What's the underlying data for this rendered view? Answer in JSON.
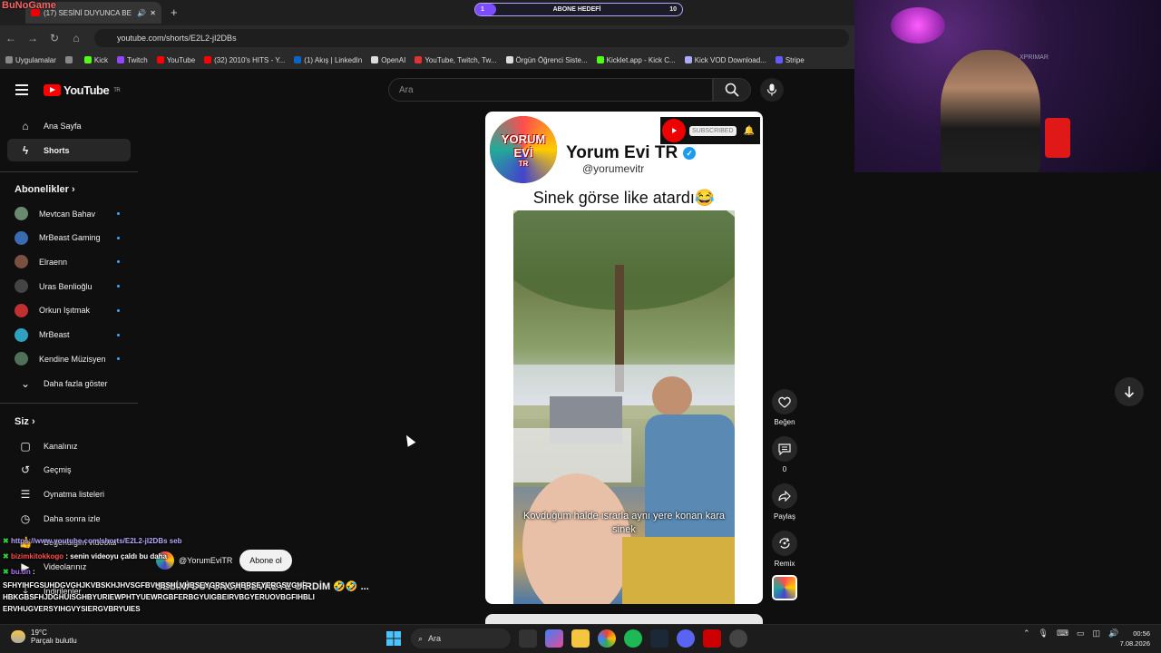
{
  "browser": {
    "tab_title": "(17) SESİNİ DUYUNCA BE",
    "new_tab": "+",
    "url": "youtube.com/shorts/E2L2-jI2DBs",
    "overlay_logo": "BuNoGame"
  },
  "subgoal": {
    "label": "ABONE HEDEFİ",
    "current": "1",
    "target": "10",
    "progress_fraction": 0.1
  },
  "bookmarks": [
    {
      "label": "Uygulamalar",
      "color": "#888888"
    },
    {
      "label": "",
      "color": "#888888"
    },
    {
      "label": "Kick",
      "color": "#53fc18"
    },
    {
      "label": "Twitch",
      "color": "#9146ff"
    },
    {
      "label": "YouTube",
      "color": "#ff0000"
    },
    {
      "label": "(32) 2010's HITS - Y...",
      "color": "#ff0000"
    },
    {
      "label": "(1) Akış | LinkedIn",
      "color": "#0a66c2"
    },
    {
      "label": "OpenAI",
      "color": "#dddddd"
    },
    {
      "label": "YouTube, Twitch, Tw...",
      "color": "#d33"
    },
    {
      "label": "Örgün Öğrenci Siste...",
      "color": "#dddddd"
    },
    {
      "label": "Kicklet.app - Kick C...",
      "color": "#53fc18"
    },
    {
      "label": "Kick VOD Download...",
      "color": "#aaaaff"
    },
    {
      "label": "Stripe",
      "color": "#635bff"
    }
  ],
  "youtube": {
    "logo": "YouTube",
    "region": "TR",
    "search_placeholder": "Ara"
  },
  "sidebar": {
    "top": [
      {
        "label": "Ana Sayfa",
        "icon": "home-icon"
      },
      {
        "label": "Shorts",
        "icon": "shorts-icon"
      }
    ],
    "subs_heading": "Abonelikler",
    "subs": [
      {
        "label": "Mevtcan Bahav",
        "color": "#6a8a70"
      },
      {
        "label": "MrBeast Gaming",
        "color": "#3a6ab0"
      },
      {
        "label": "Elraenn",
        "color": "#7a5040"
      },
      {
        "label": "Uras Benlioğlu",
        "color": "#444444"
      },
      {
        "label": "Orkun Işıtmak",
        "color": "#c03030"
      },
      {
        "label": "MrBeast",
        "color": "#30a0c0"
      },
      {
        "label": "Kendine Müzisyen",
        "color": "#50705a"
      }
    ],
    "more": "Daha fazla göster",
    "you_heading": "Siz",
    "you": [
      {
        "label": "Kanalınız",
        "icon": "user-icon"
      },
      {
        "label": "Geçmiş",
        "icon": "history-icon"
      },
      {
        "label": "Oynatma listeleri",
        "icon": "playlist-icon"
      },
      {
        "label": "Daha sonra izle",
        "icon": "clock-icon"
      },
      {
        "label": "Beğendiğim videolar",
        "icon": "like-icon"
      },
      {
        "label": "Videolarınız",
        "icon": "video-icon"
      },
      {
        "label": "İndirilenler",
        "icon": "download-icon"
      }
    ]
  },
  "short": {
    "channel_name": "Yorum Evi TR",
    "handle": "@yorumevitr",
    "subscribe_badge": "SUBSCRIBED",
    "logo_top": "YORUM",
    "logo_bottom": "EVİ",
    "logo_tr": "TR",
    "caption": "Sinek görse like atardı😂",
    "subtitle": "Kovduğum halde ısrarla aynı yere konan kara sinek",
    "overlay_channel": "@YorumEviTR",
    "overlay_subscribe": "Abone ol",
    "overlay_title": "SESİNİ DUYUNCA DEVREYE GİRDİM 🤣🤣 ..."
  },
  "actions": {
    "like": "Beğen",
    "comments_count": "0",
    "share": "Paylaş",
    "remix": "Remix"
  },
  "chat": [
    {
      "user": "",
      "text": "https://www.youtube.com/shorts/E2L2-jI2DBs seb"
    },
    {
      "user": "bizimkitokkogo",
      "text": ": senin videoyu çaldı bu daha"
    },
    {
      "user": "bu.un",
      "text": ":"
    },
    {
      "user": "",
      "text": "SFHYIHFGSUHDGVGHJKVBSKHJHVSGFBVHBSHLVHBSEYGRSVGHBRSEYERGSVGHF"
    },
    {
      "user": "",
      "text": "HBKGBSFHJDGHUISGHBYURIEWPHTYUEWRGBFERBGYUIGBEIRVBGYERUOVBGFIHBLI"
    },
    {
      "user": "",
      "text": "ERVHUGVERSYIHGVYSIERGVBRYUIES"
    }
  ],
  "taskbar": {
    "temp": "19°C",
    "weather": "Parçalı bulutlu",
    "search": "Ara",
    "time": "00:56",
    "date": "7.08.2026"
  },
  "webcam": {
    "watermark": "XPRIMAR"
  }
}
